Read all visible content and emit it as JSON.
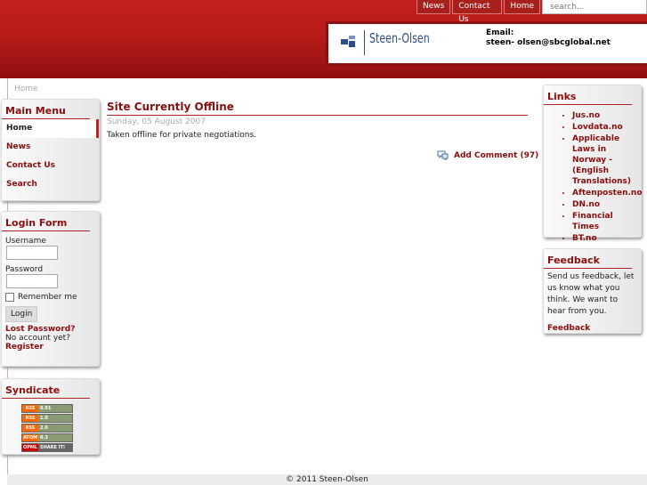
{
  "topnav": {
    "items": [
      "News",
      "Contact Us",
      "Home"
    ],
    "search_placeholder": "search..."
  },
  "brand": {
    "logo_text": "Steen-Olsen",
    "email_label": "Email:",
    "email_value": "steen- olsen@sbcglobal.net"
  },
  "breadcrumb": "Home",
  "main_menu": {
    "title": "Main Menu",
    "items": [
      "Home",
      "News",
      "Contact Us",
      "Search"
    ],
    "active": "Home"
  },
  "login_form": {
    "title": "Login Form",
    "username_label": "Username",
    "password_label": "Password",
    "remember_label": "Remember me",
    "login_button": "Login",
    "lost_password": "Lost Password?",
    "no_account": "No account yet?",
    "register": "Register"
  },
  "syndicate": {
    "title": "Syndicate",
    "feeds": [
      [
        "RSS",
        "0.91"
      ],
      [
        "RSS",
        "1.0"
      ],
      [
        "RSS",
        "2.0"
      ],
      [
        "ATOM",
        "0.3"
      ],
      [
        "OPML",
        "SHARE IT!"
      ]
    ]
  },
  "article": {
    "title": "Site Currently Offline",
    "date": "Sunday, 05 August 2007",
    "text": "Taken offline for private negotiations.",
    "comment_link": "Add Comment (97)"
  },
  "links": {
    "title": "Links",
    "items": [
      "Jus.no",
      "Lovdata.no",
      "Applicable Laws in Norway - (English Translations)",
      "Aftenposten.no",
      "DN.no",
      "Financial Times",
      "BT.no"
    ]
  },
  "feedback": {
    "title": "Feedback",
    "text": "Send us feedback, let us know what you think. We want to hear from you.",
    "link": "Feedback"
  },
  "footer": "© 2011 Steen-Olsen",
  "colors": {
    "header_red": "#b81c19",
    "accent": "#8b0d0d",
    "logo_blue": "#2c4f8b"
  }
}
